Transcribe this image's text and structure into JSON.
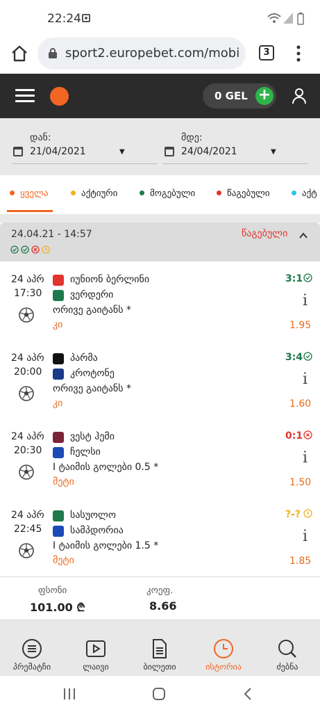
{
  "status_bar": {
    "time": "22:24"
  },
  "browser": {
    "url": "sport2.europebet.com/mobi",
    "tab_count": "3"
  },
  "header": {
    "balance": "0 GEL"
  },
  "filter": {
    "from_label": "დან:",
    "from_value": "21/04/2021",
    "to_label": "მდე:",
    "to_value": "24/04/2021"
  },
  "status_tabs": [
    {
      "label": "ყველა",
      "color": "#f26522"
    },
    {
      "label": "აქტიური",
      "color": "#f2b01e"
    },
    {
      "label": "მოგებული",
      "color": "#1e7a4b"
    },
    {
      "label": "წაგებული",
      "color": "#e3342f"
    },
    {
      "label": "აქტ",
      "color": "#2ec4e6"
    }
  ],
  "ticket": {
    "datetime": "24.04.21 - 14:57",
    "status": "წაგებული"
  },
  "bets": [
    {
      "date": "24 აპრ",
      "time": "17:30",
      "home": "იუნიონ ბერლინი",
      "away": "ვერდერი",
      "market": "ორივე გაიტანს *",
      "pick": "კი",
      "score": "3:1",
      "odds": "1.95",
      "result": "won",
      "result_color": "#1e7a4b"
    },
    {
      "date": "24 აპრ",
      "time": "20:00",
      "home": "პარმა",
      "away": "კროტონე",
      "market": "ორივე გაიტანს *",
      "pick": "კი",
      "score": "3:4",
      "odds": "1.60",
      "result": "won",
      "result_color": "#1e7a4b"
    },
    {
      "date": "24 აპრ",
      "time": "20:30",
      "home": "ვესტ ჰემი",
      "away": "ჩელსი",
      "market": "I ტაიმის გოლები 0.5 *",
      "pick": "მეტი",
      "score": "0:1",
      "odds": "1.50",
      "result": "lost",
      "result_color": "#e3342f"
    },
    {
      "date": "24 აპრ",
      "time": "22:45",
      "home": "სასუოლო",
      "away": "სამპდორია",
      "market": "I ტაიმის გოლები 1.5 *",
      "pick": "მეტი",
      "score": "?-?",
      "odds": "1.85",
      "result": "pending",
      "result_color": "#f2b01e"
    }
  ],
  "summary": {
    "stake_label": "ფსონი",
    "stake_value": "101.00 ₾",
    "coef_label": "კოეფ.",
    "coef_value": "8.66"
  },
  "bottom_nav": [
    {
      "label": "პრემატჩი",
      "icon": "list-circle-icon"
    },
    {
      "label": "ლაივი",
      "icon": "play-icon"
    },
    {
      "label": "ბილეთი",
      "icon": "document-icon"
    },
    {
      "label": "ისტორია",
      "icon": "clock-icon",
      "active": true
    },
    {
      "label": "ძებნა",
      "icon": "search-icon"
    }
  ],
  "colors": {
    "accent": "#f26522",
    "header_bg": "#2b2b2b",
    "won": "#1e7a4b",
    "lost": "#e3342f",
    "pending": "#f2b01e"
  }
}
